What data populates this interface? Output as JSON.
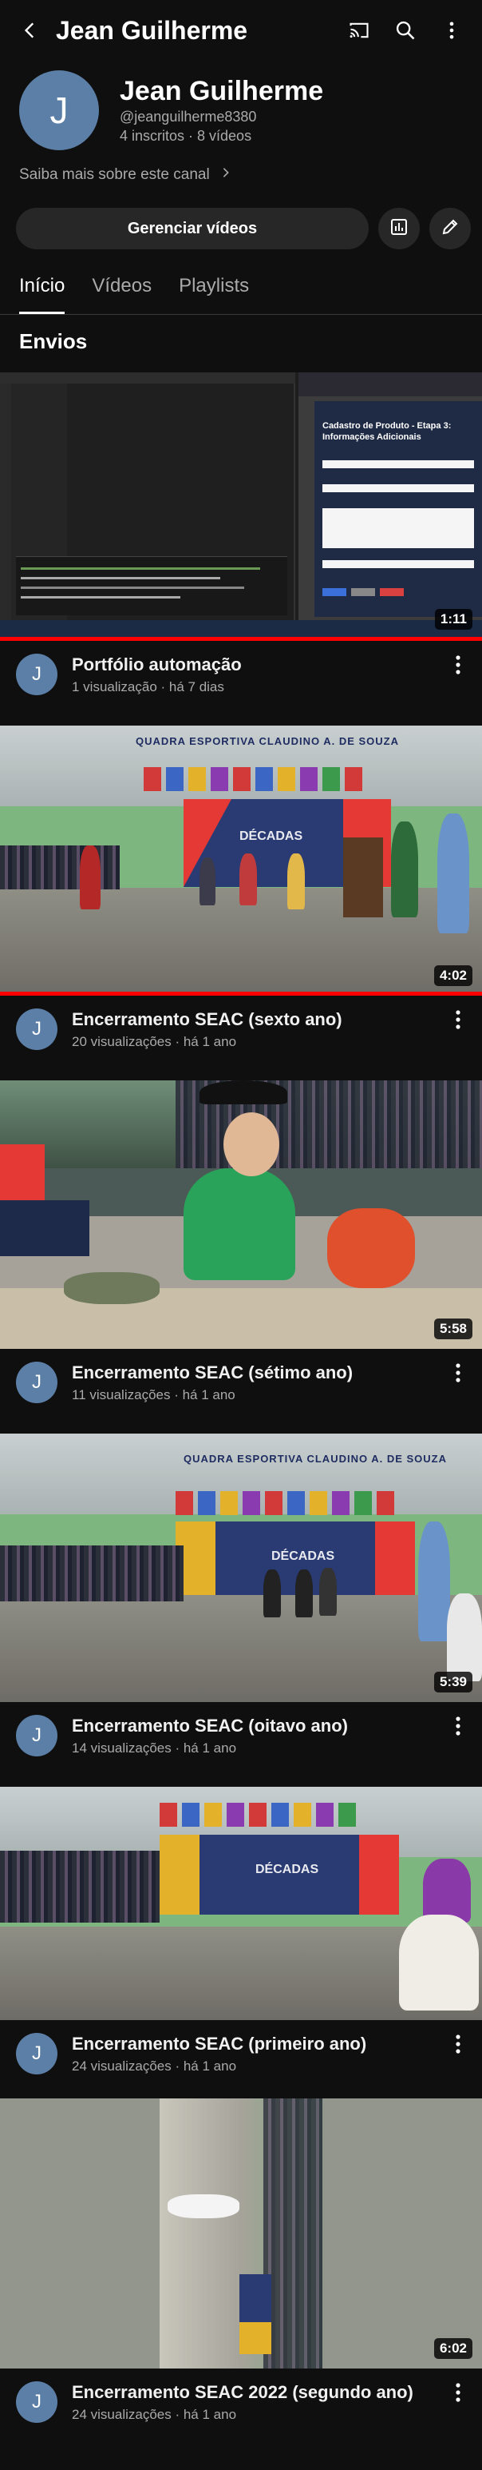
{
  "topbar": {
    "title": "Jean Guilherme"
  },
  "channel": {
    "avatar_letter": "J",
    "name": "Jean Guilherme",
    "handle": "@jeanguilherme8380",
    "stats": "4 inscritos · 8 vídeos",
    "more_info": "Saiba mais sobre este canal"
  },
  "actions": {
    "manage_label": "Gerenciar vídeos"
  },
  "tabs": [
    {
      "label": "Início",
      "active": true
    },
    {
      "label": "Vídeos",
      "active": false
    },
    {
      "label": "Playlists",
      "active": false
    }
  ],
  "section": {
    "title": "Envios"
  },
  "videos": [
    {
      "title": "Portfólio automação",
      "sub": "1 visualização · há 7 dias",
      "duration": "1:11",
      "watched": 1.0
    },
    {
      "title": "Encerramento SEAC (sexto ano)",
      "sub": "20 visualizações · há 1 ano",
      "duration": "4:02",
      "watched": 1.0
    },
    {
      "title": "Encerramento SEAC (sétimo ano)",
      "sub": "11 visualizações · há 1 ano",
      "duration": "5:58",
      "watched": 0
    },
    {
      "title": "Encerramento SEAC (oitavo ano)",
      "sub": "14 visualizações · há 1 ano",
      "duration": "5:39",
      "watched": 0
    },
    {
      "title": "Encerramento SEAC (primeiro ano)",
      "sub": "24 visualizações · há 1 ano",
      "duration": "",
      "watched": 0
    },
    {
      "title": "Encerramento SEAC 2022 (segundo ano)",
      "sub": "24 visualizações · há 1 ano",
      "duration": "6:02",
      "watched": 0
    }
  ],
  "thumb_text": {
    "form_title": "Cadastro de Produto - Etapa 3: Informações Adicionais",
    "gym_sign": "QUADRA ESPORTIVA CLAUDINO A. DE SOUZA",
    "decadas": "DÉCADAS"
  },
  "colors": {
    "background": "#0f0f0f",
    "surface": "#272727",
    "avatar": "#5b7fa6",
    "progress": "#ff0000",
    "secondary_text": "#aaaaaa"
  },
  "icons": [
    "back-arrow-icon",
    "cast-icon",
    "search-icon",
    "more-vert-icon",
    "chevron-right-icon",
    "analytics-icon",
    "edit-pencil-icon"
  ]
}
